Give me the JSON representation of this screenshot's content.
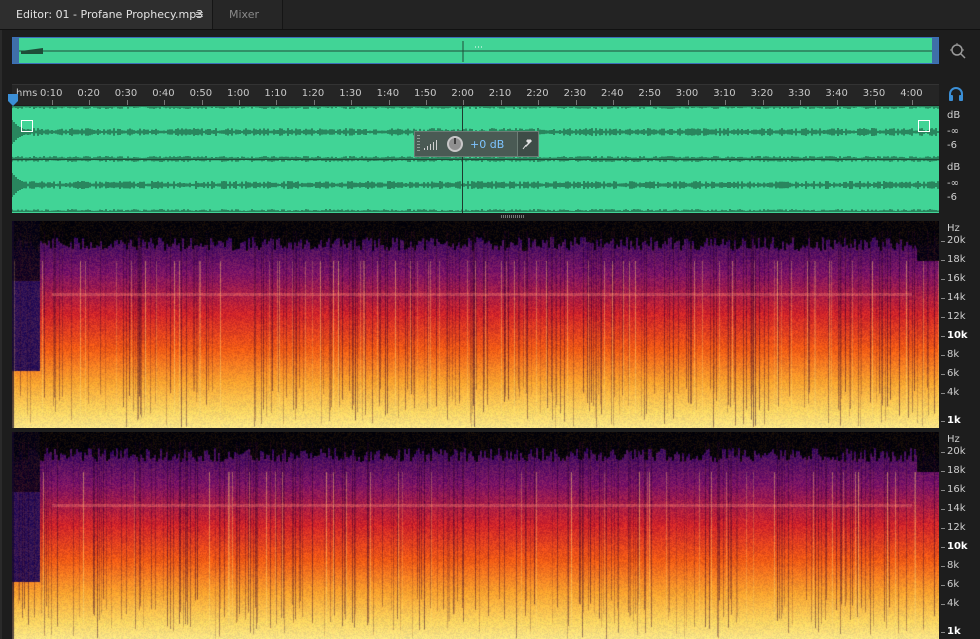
{
  "tabs": {
    "editor_label": "Editor: 01 - Profane Prophecy.mp3",
    "editor_menu_icon": "≡",
    "mixer_label": "Mixer"
  },
  "ruler": {
    "unit": "hms",
    "labels": [
      "0:10",
      "0:20",
      "0:30",
      "0:40",
      "0:50",
      "1:00",
      "1:10",
      "1:20",
      "1:30",
      "1:40",
      "1:50",
      "2:00",
      "2:10",
      "2:20",
      "2:30",
      "2:40",
      "2:50",
      "3:00",
      "3:10",
      "3:20",
      "3:30",
      "3:40",
      "3:50",
      "4:00"
    ]
  },
  "hud": {
    "value": "+0 dB"
  },
  "db_axis": {
    "ch1": [
      "dB",
      "-∞",
      "-6"
    ],
    "ch2": [
      "dB",
      "-∞",
      "-6"
    ]
  },
  "hz_axis": {
    "unit": "Hz",
    "labels": [
      "20k",
      "18k",
      "16k",
      "14k",
      "12k",
      "10k",
      "8k",
      "6k",
      "4k",
      "1k"
    ]
  },
  "colors": {
    "waveform": "#41d496",
    "accent": "#3b8fd6",
    "hud_value": "#7ec4ff"
  },
  "icons": [
    "zoom-icon",
    "headphone-icon",
    "playhead-marker-icon",
    "volume-bars-icon",
    "volume-knob-icon",
    "pin-icon",
    "menu-icon"
  ]
}
